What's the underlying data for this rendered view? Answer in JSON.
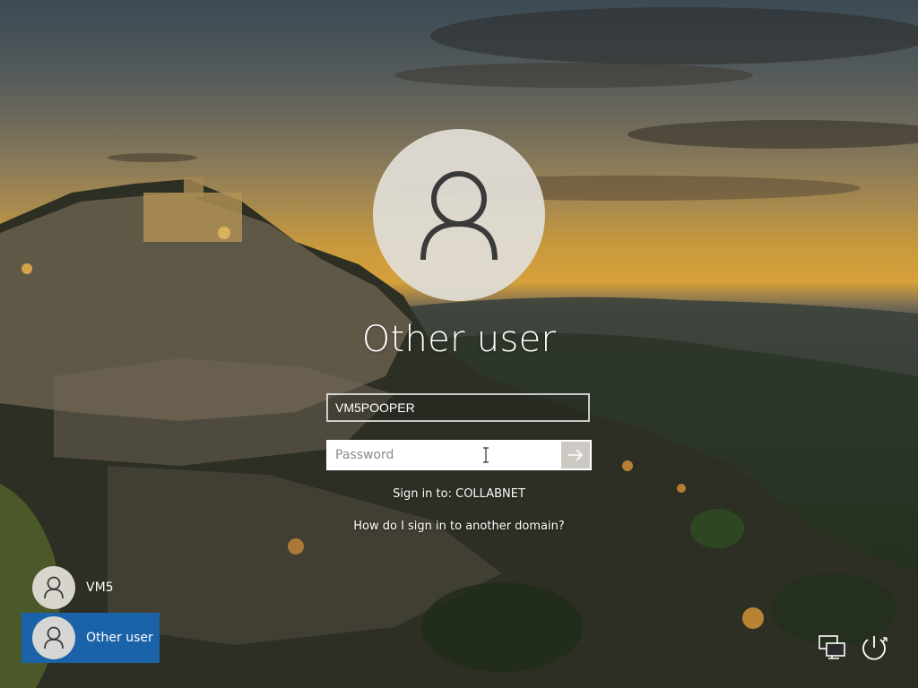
{
  "login": {
    "title": "Other user",
    "username_value": "VM5POOPER",
    "password_placeholder": "Password",
    "sign_in_to": "Sign in to: COLLABNET",
    "domain_help_link": "How do I sign in to another domain?"
  },
  "users": [
    {
      "name": "VM5",
      "selected": false
    },
    {
      "name": "Other user",
      "selected": true
    }
  ],
  "icons": {
    "avatar": "person-icon",
    "submit": "arrow-right-icon",
    "network": "network-icon",
    "power": "power-icon"
  },
  "colors": {
    "selected_user_bg": "#1b63a8",
    "avatar_bg": "#e0ddd6",
    "submit_bg": "#ccc9c3"
  }
}
